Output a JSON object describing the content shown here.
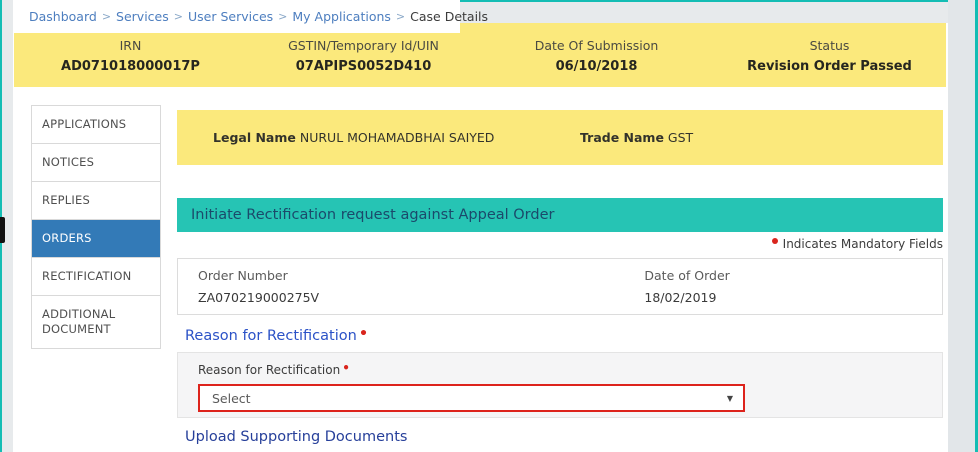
{
  "colors": {
    "accent_teal": "#14bdb4",
    "banner_teal": "#26c4b4",
    "header_yellow": "#fbe97c",
    "active_blue": "#337ab7",
    "heading_blue": "#2b52c7",
    "mandatory_red": "#d9251d",
    "page_gray": "#e7eaec"
  },
  "breadcrumb": {
    "separator": ">",
    "items": [
      {
        "label": "Dashboard"
      },
      {
        "label": "Services"
      },
      {
        "label": "User Services"
      },
      {
        "label": "My Applications"
      }
    ],
    "current": "Case Details"
  },
  "case_header": {
    "fields": [
      {
        "label": "IRN",
        "value": "AD071018000017P"
      },
      {
        "label": "GSTIN/Temporary Id/UIN",
        "value": "07APIPS0052D410"
      },
      {
        "label": "Date Of Submission",
        "value": "06/10/2018"
      },
      {
        "label": "Status",
        "value": "Revision Order Passed"
      }
    ]
  },
  "sidebar": {
    "items": [
      {
        "label": "APPLICATIONS",
        "active": false
      },
      {
        "label": "NOTICES",
        "active": false
      },
      {
        "label": "REPLIES",
        "active": false
      },
      {
        "label": "ORDERS",
        "active": true
      },
      {
        "label": "RECTIFICATION",
        "active": false
      },
      {
        "label": "ADDITIONAL DOCUMENT",
        "active": false
      }
    ]
  },
  "party": {
    "legal_name_label": "Legal Name",
    "legal_name": "NURUL MOHAMADBHAI SAIYED",
    "trade_name_label": "Trade Name",
    "trade_name": "GST"
  },
  "section": {
    "banner_title": "Initiate Rectification request against Appeal Order",
    "mandatory_note": "Indicates Mandatory Fields"
  },
  "order": {
    "number_label": "Order Number",
    "number": "ZA070219000275V",
    "date_label": "Date of Order",
    "date": "18/02/2019"
  },
  "rectification": {
    "heading": "Reason for Rectification",
    "field_label": "Reason for Rectification",
    "select_value": "Select",
    "caret": "▼"
  },
  "upload": {
    "heading": "Upload Supporting Documents"
  }
}
